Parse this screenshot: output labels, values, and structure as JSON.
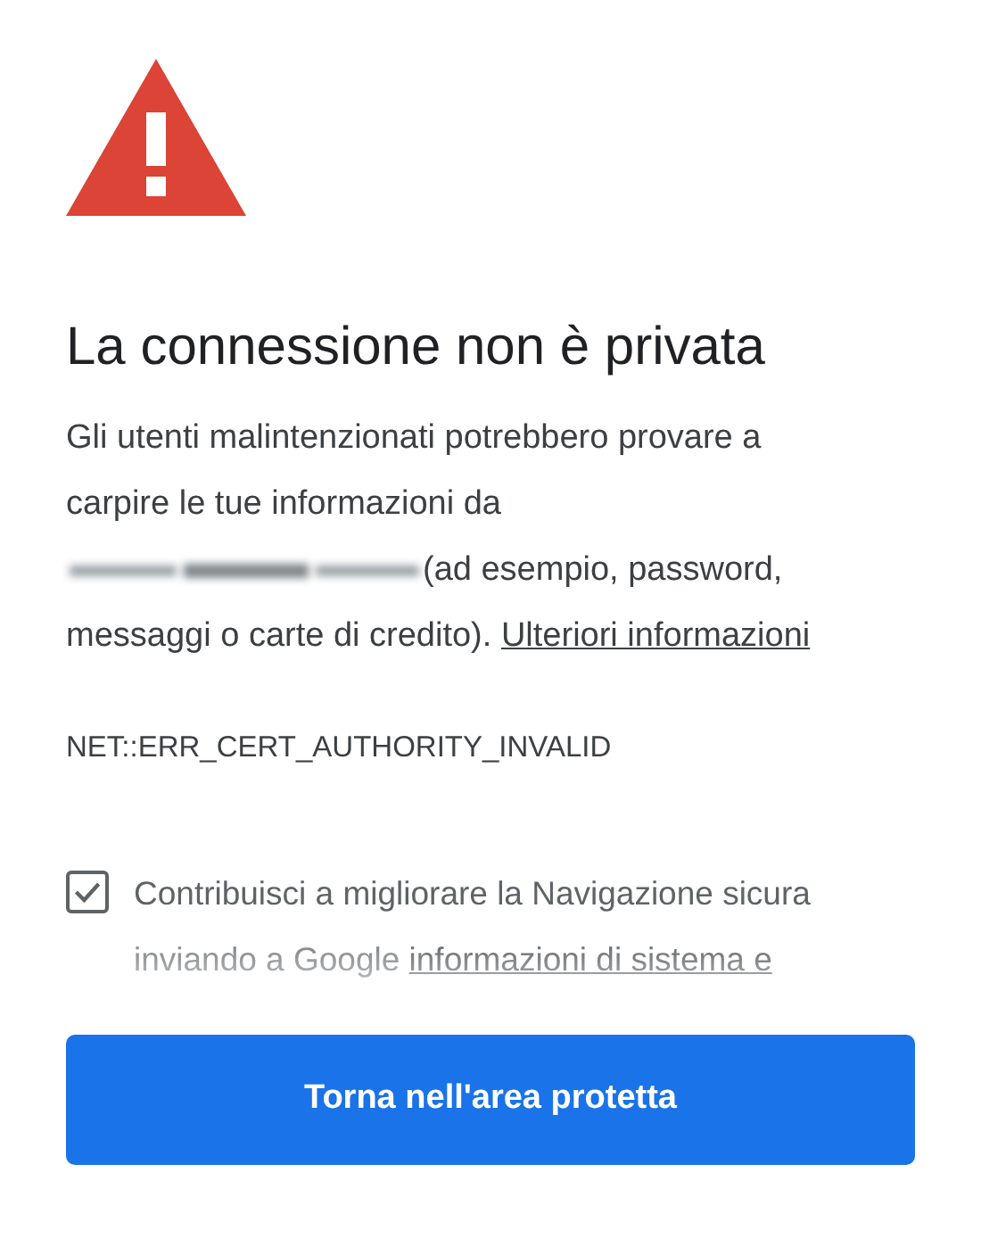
{
  "title": "La connessione non è privata",
  "description": {
    "text_before": "Gli utenti malintenzionati potrebbero provare a carpire le tue informazioni da",
    "text_after": "(ad esempio, password, messaggi o carte di credito).",
    "link": "Ulteriori informazioni"
  },
  "error_code": "NET::ERR_CERT_AUTHORITY_INVALID",
  "report_option": {
    "checked": true,
    "text": "Contribuisci a migliorare la Navigazione sicura inviando a Google",
    "link": "informazioni di sistema e"
  },
  "button": "Torna nell'area protetta"
}
